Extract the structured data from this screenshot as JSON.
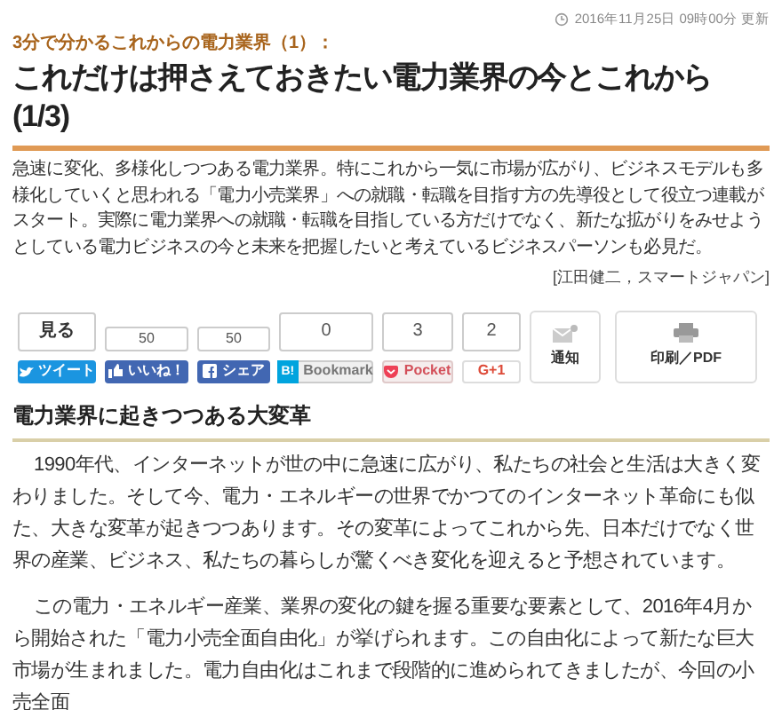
{
  "article": {
    "updated": "2016年11月25日 09時00分 更新",
    "series": "3分で分かるこれからの電力業界（1）：",
    "title": "これだけは押さえておきたい電力業界の今とこれから (1/3)",
    "lead": "急速に変化、多様化しつつある電力業界。特にこれから一気に市場が広がり、ビジネスモデルも多様化していくと思われる「電力小売業界」への就職・転職を目指す方の先導役として役立つ連載がスタート。実際に電力業界への就職・転職を目指している方だけでなく、新たな拡がりをみせようとしている電力ビジネスの今と未来を把握したいと考えているビジネスパーソンも必見だ。",
    "byline": "[江田健二，スマートジャパン]"
  },
  "share_buttons": [
    {
      "kind": "tweet",
      "count": "見る",
      "label": "ツイート"
    },
    {
      "kind": "like",
      "count": "50",
      "label": "いいね！"
    },
    {
      "kind": "share",
      "count": "50",
      "label": "シェア"
    },
    {
      "kind": "bookmark",
      "count": "0",
      "label": "Bookmark",
      "badge": "B!"
    },
    {
      "kind": "pocket",
      "count": "3",
      "label": "Pocket"
    },
    {
      "kind": "gplus",
      "count": "2",
      "label": "G+1"
    },
    {
      "kind": "notify",
      "label": "通知"
    },
    {
      "kind": "print",
      "label": "印刷／PDF"
    }
  ],
  "section": {
    "heading": "電力業界に起きつつある大変革",
    "paragraphs": [
      "1990年代、インターネットが世の中に急速に広がり、私たちの社会と生活は大きく変わりました。そして今、電力・エネルギーの世界でかつてのインターネット革命にも似た、大きな変革が起きつつあります。その変革によってこれから先、日本だけでなく世界の産業、ビジネス、私たちの暮らしが驚くべき変化を迎えると予想されています。",
      "この電力・エネルギー産業、業界の変化の鍵を握る重要な要素として、2016年4月から開始された「電力小売全面自由化」が挙げられます。この自由化によって新たな巨大市場が生まれました。電力自由化はこれまで段階的に進められてきましたが、今回の小売全面"
    ]
  }
}
